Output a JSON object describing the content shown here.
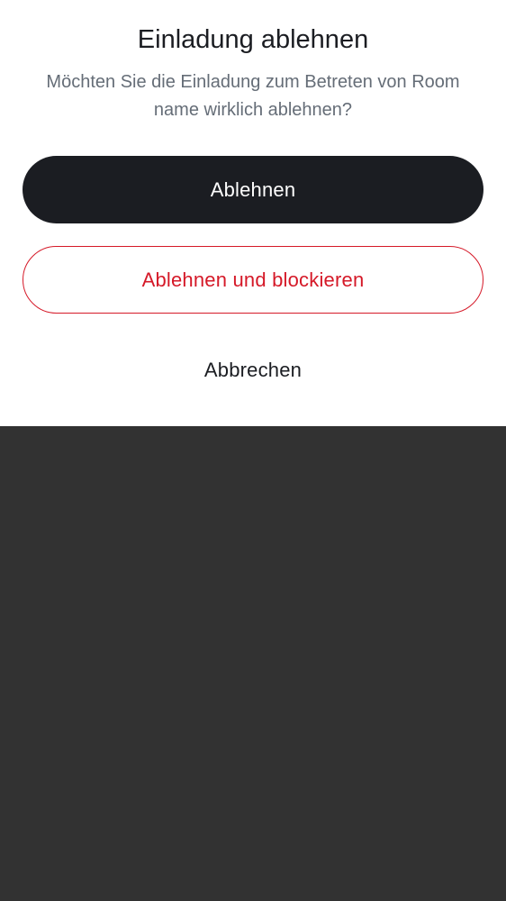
{
  "dialog": {
    "title": "Einladung ablehnen",
    "message": "Möchten Sie die Einladung zum Betreten von Room name wirklich ablehnen?",
    "decline_label": "Ablehnen",
    "decline_block_label": "Ablehnen und blockieren",
    "cancel_label": "Abbrechen"
  },
  "colors": {
    "primary": "#1b1d22",
    "danger": "#d51928",
    "secondary_text": "#656d77",
    "scrim": "#323232"
  }
}
